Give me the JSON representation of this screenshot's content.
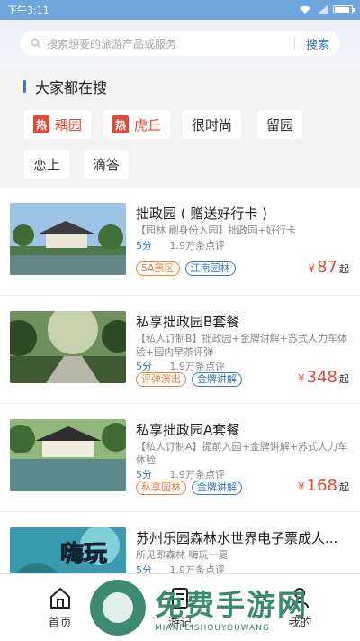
{
  "status": {
    "time": "下午3:11",
    "battery_level": 0.8
  },
  "search": {
    "placeholder": "搜索想要的旅游产品或服务",
    "button": "搜索"
  },
  "hot": {
    "title": "大家都在搜",
    "badge": "热",
    "tags": [
      {
        "label": "耦园",
        "hot": true
      },
      {
        "label": "虎丘",
        "hot": true
      },
      {
        "label": "很时尚",
        "hot": false
      },
      {
        "label": "留园",
        "hot": false
      },
      {
        "label": "恋上",
        "hot": false
      },
      {
        "label": "滴答",
        "hot": false
      }
    ]
  },
  "products": [
    {
      "title": "拙政园 ( 赠送好行卡 )",
      "desc": "【园林 刷身份入园】拙政园+好行卡",
      "score": "5分",
      "reviews": "1.9万条点评",
      "badges": [
        {
          "text": "5A景区",
          "color": "orange"
        },
        {
          "text": "江南园林",
          "color": "blue"
        }
      ],
      "currency": "¥",
      "price": "87",
      "unit": "起"
    },
    {
      "title": "私享拙政园B套餐",
      "desc": "【私人订制B】拙政园+金牌讲解+苏式人力车体验+园内早茶评弹",
      "score": "5分",
      "reviews": "1.9万条点评",
      "badges": [
        {
          "text": "评弹演出",
          "color": "orange"
        },
        {
          "text": "金牌讲解",
          "color": "blue"
        }
      ],
      "currency": "¥",
      "price": "348",
      "unit": "起"
    },
    {
      "title": "私享拙政园A套餐",
      "desc": "【私人订制A】提前入园+金牌讲解+苏式人力车体验",
      "score": "5分",
      "reviews": "1.9万条点评",
      "badges": [
        {
          "text": "私享园林",
          "color": "orange"
        },
        {
          "text": "金牌讲解",
          "color": "blue"
        }
      ],
      "currency": "¥",
      "price": "168",
      "unit": "起"
    },
    {
      "title": "苏州乐园森林水世界电子票成人...",
      "desc": "所见即森林 嗨玩一夏",
      "score": "5分",
      "reviews": "1.9万条点评",
      "thumb_text": "嗨玩"
    }
  ],
  "tabs": [
    {
      "label": "首页",
      "icon": "home-icon"
    },
    {
      "label": "游记",
      "icon": "notes-icon"
    },
    {
      "label": "我的",
      "icon": "user-icon"
    }
  ],
  "watermark": {
    "title": "免费手游网",
    "subtitle": "MIANFEISHOUYOUWANG"
  }
}
